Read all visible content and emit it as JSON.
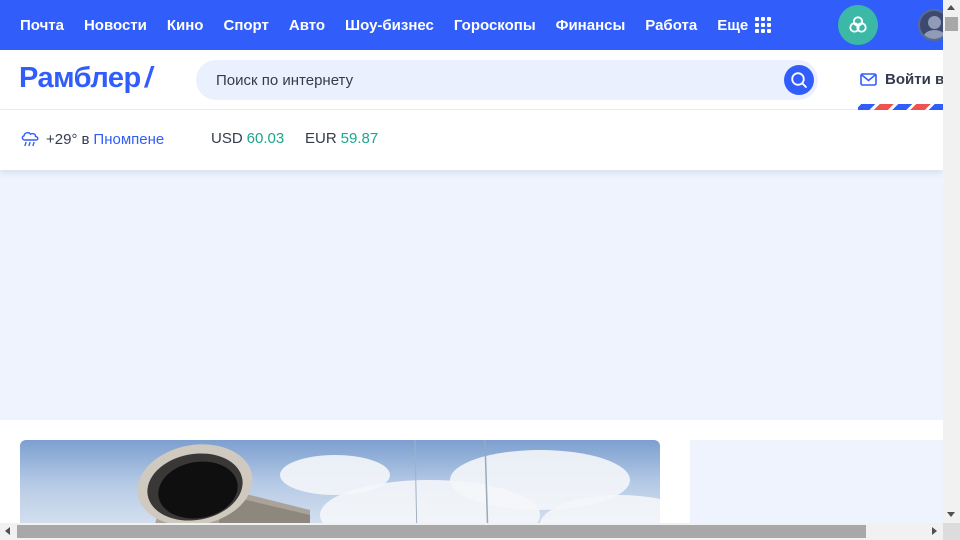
{
  "nav": {
    "items": [
      "Почта",
      "Новости",
      "Кино",
      "Спорт",
      "Авто",
      "Шоу-бизнес",
      "Гороскопы",
      "Финансы",
      "Работа"
    ],
    "more_label": "Еще"
  },
  "header": {
    "logo": "Рамблер",
    "logo_slash": "/",
    "search_placeholder": "Поиск по интернету",
    "login_label": "Войти в"
  },
  "info": {
    "weather_temp": "+29°",
    "weather_prep": "в",
    "weather_city": "Пномпене",
    "usd_label": "USD",
    "usd_value": "60.03",
    "eur_label": "EUR",
    "eur_value": "59.87"
  },
  "colors": {
    "brand_blue": "#315efb",
    "ai_green": "#3cb9a6",
    "currency_green": "#1ba78e",
    "banner_bg": "#eef3fe"
  },
  "icons": {
    "apps": "grid-icon",
    "ai": "neural-knot-icon",
    "search": "search-icon",
    "login": "envelope-icon",
    "weather": "rain-cloud-icon"
  }
}
